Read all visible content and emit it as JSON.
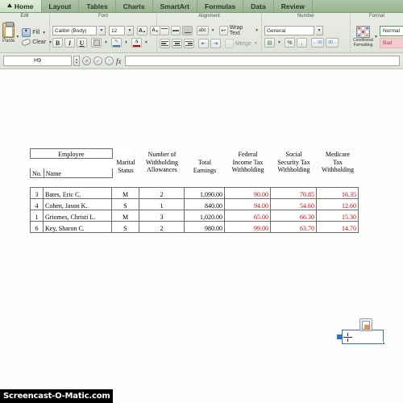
{
  "tabs": [
    {
      "label": "Home",
      "icon": "home-icon",
      "active": true
    },
    {
      "label": "Layout",
      "active": false
    },
    {
      "label": "Tables",
      "active": false
    },
    {
      "label": "Charts",
      "active": false
    },
    {
      "label": "SmartArt",
      "active": false
    },
    {
      "label": "Formulas",
      "active": false
    },
    {
      "label": "Data",
      "active": false
    },
    {
      "label": "Review",
      "active": false
    }
  ],
  "ribbon": {
    "groups": [
      {
        "label": "Edit"
      },
      {
        "label": "Font"
      },
      {
        "label": "Alignment"
      },
      {
        "label": "Number"
      },
      {
        "label": "Format"
      }
    ],
    "edit": {
      "paste_label": "Paste",
      "fill_label": "Fill",
      "clear_label": "Clear"
    },
    "font": {
      "font_name": "Calibri (Body)",
      "font_size": "12",
      "grow_font": "A",
      "shrink_font": "A",
      "bold": "B",
      "italic": "I",
      "underline": "U",
      "borders": "borders-icon",
      "fill_color": "fill-color-icon",
      "font_color": "A"
    },
    "alignment": {
      "align_top": "align-top-icon",
      "align_middle": "align-middle-icon",
      "align_bottom": "align-bottom-icon",
      "orientation": "abc",
      "wrap_text": "Wrap Text",
      "align_left": "align-left-icon",
      "align_center": "align-center-icon",
      "align_right": "align-right-icon",
      "decrease_indent": "decrease-indent-icon",
      "increase_indent": "increase-indent-icon",
      "merge": "Merge"
    },
    "number": {
      "format": "General",
      "currency": "currency-icon",
      "percent": "%",
      "comma": ",",
      "increase_decimal": ".00",
      "decrease_decimal": ".00"
    },
    "format": {
      "conditional_formatting": "Conditional Formatting",
      "style_normal": "Normal",
      "style_bad": "Bad"
    }
  },
  "formula_bar": {
    "name_box": "H9",
    "cancel": "cancel-icon",
    "accept": "accept-icon",
    "function_wizard": "fx",
    "formula_value": ""
  },
  "table": {
    "group_header": "Employee",
    "headers": [
      {
        "key": "no",
        "label": "No."
      },
      {
        "key": "name",
        "label": "Name"
      },
      {
        "key": "marital",
        "line1": "Marital",
        "line2": "Status"
      },
      {
        "key": "allowances",
        "line1": "Number of",
        "line2": "Withholding",
        "line3": "Allowances"
      },
      {
        "key": "total",
        "line1": "Total",
        "line2": "Earnings"
      },
      {
        "key": "federal",
        "line1": "Federal",
        "line2": "Income Tax",
        "line3": "Withholding"
      },
      {
        "key": "social",
        "line1": "Social",
        "line2": "Security Tax",
        "line3": "Withholding"
      },
      {
        "key": "medicare",
        "line1": "Medicare",
        "line2": "Tax",
        "line3": "Withholding"
      }
    ],
    "rows": [
      {
        "no": "3",
        "name": "Bates, Eric C.",
        "marital": "M",
        "allowances": "2",
        "total": "1,090.00",
        "federal": "90.00",
        "social": "70.85",
        "medicare": "16.35"
      },
      {
        "no": "4",
        "name": "Cohen, Jason K.",
        "marital": "S",
        "allowances": "1",
        "total": "840.00",
        "federal": "94.00",
        "social": "54.60",
        "medicare": "12.60"
      },
      {
        "no": "1",
        "name": "Griomes, Christi L.",
        "marital": "M",
        "allowances": "3",
        "total": "1,020.00",
        "federal": "65.00",
        "social": "66.30",
        "medicare": "15.30"
      },
      {
        "no": "6",
        "name": "Key, Sharon C.",
        "marital": "S",
        "allowances": "2",
        "total": "980.00",
        "federal": "99.00",
        "social": "63.70",
        "medicare": "14.70"
      }
    ]
  },
  "selection": {
    "selected_cell": "",
    "paste_options": "paste-options-icon",
    "cursor": "cross-cursor"
  },
  "watermark": {
    "text": "Screencast-O-Matic.com"
  },
  "colors": {
    "tab_bar": "#a5bd9e",
    "active_tab": "#d7e9d2",
    "ribbon": "#e4e8df",
    "red_value": "#e00000",
    "selection_blue": "#2f6fd0",
    "style_good_border": "#4ca64c",
    "style_bad_bg": "#f6cbcf"
  }
}
